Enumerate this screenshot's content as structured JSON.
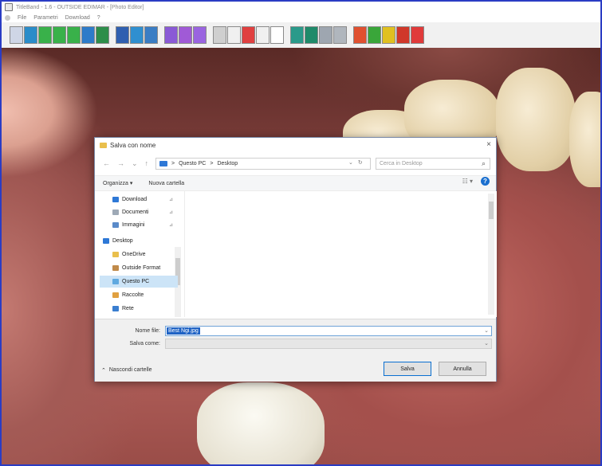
{
  "window": {
    "title": "TitleBand - 1.6 - OUTSIDE EDIMAR - [Photo Editor]"
  },
  "menubar": {
    "items": [
      "File",
      "Parametri",
      "Download",
      "?"
    ]
  },
  "toolbar": {
    "groups": [
      [
        {
          "icon": "grid-icon",
          "color": "#cfd6e6"
        },
        {
          "icon": "arrows-icon",
          "color": "#2a8cc9"
        },
        {
          "icon": "rotate-left-icon",
          "color": "#39b14a"
        },
        {
          "icon": "rotate-right-icon",
          "color": "#39b14a"
        },
        {
          "icon": "flip-icon",
          "color": "#39b14a"
        },
        {
          "icon": "crop-icon",
          "color": "#2d7bc9"
        },
        {
          "icon": "image-icon",
          "color": "#2d8e4a"
        }
      ],
      [
        {
          "icon": "portrait-icon",
          "color": "#2f5fb0"
        },
        {
          "icon": "landscape-icon",
          "color": "#2f8fd0"
        },
        {
          "icon": "contrast-icon",
          "color": "#3a7dc4"
        }
      ],
      [
        {
          "icon": "width-icon",
          "color": "#8a5ad6"
        },
        {
          "icon": "height-icon",
          "color": "#a05ad6"
        },
        {
          "icon": "zoom-icon",
          "color": "#9a64e0"
        }
      ],
      [
        {
          "icon": "frame-icon",
          "color": "#cfcfcf"
        },
        {
          "icon": "pointer-icon",
          "color": "#f0f0f0"
        },
        {
          "icon": "lips-icon",
          "color": "#e04040"
        },
        {
          "icon": "tooth-icon",
          "color": "#f0f0f0"
        },
        {
          "icon": "target-icon",
          "color": "#ffffff"
        }
      ],
      [
        {
          "icon": "print-icon",
          "color": "#2a9a8a"
        },
        {
          "icon": "save-icon",
          "color": "#1f8a6a"
        },
        {
          "icon": "scan-icon",
          "color": "#9ea6b0"
        },
        {
          "icon": "document-icon",
          "color": "#b0b6bd"
        }
      ],
      [
        {
          "icon": "pdf-icon",
          "color": "#e05030"
        },
        {
          "icon": "check-icon",
          "color": "#3aa63a"
        },
        {
          "icon": "info-icon",
          "color": "#e0c020"
        },
        {
          "icon": "exit-icon",
          "color": "#d0382a"
        },
        {
          "icon": "power-icon",
          "color": "#e03a3a"
        }
      ]
    ]
  },
  "dialog": {
    "title": "Salva con nome",
    "close_glyph": "×",
    "nav_glyphs": [
      "←",
      "→",
      "⌄",
      "↑"
    ],
    "breadcrumb": [
      "Questo PC",
      "Desktop"
    ],
    "breadcrumb_sep": ">",
    "address_tail": [
      "⌄",
      "↻"
    ],
    "search_placeholder": "Cerca in Desktop",
    "search_glyph": "⌕",
    "organize_label": "Organizza ▾",
    "new_folder_label": "Nuova cartella",
    "view_glyph": "☷ ▾",
    "help_glyph": "?",
    "nav_items": [
      {
        "label": "Download",
        "icon": "download-icon",
        "color": "#2e78d6",
        "pinned": true,
        "selected": false
      },
      {
        "label": "Documenti",
        "icon": "documents-icon",
        "color": "#9ea9b6",
        "pinned": true,
        "selected": false
      },
      {
        "label": "Immagini",
        "icon": "pictures-icon",
        "color": "#5a8bc9",
        "pinned": true,
        "selected": false
      },
      {
        "label": "Desktop",
        "icon": "desktop-icon",
        "color": "#2e78d6",
        "pinned": false,
        "selected": false
      },
      {
        "label": "OneDrive",
        "icon": "onedrive-folder-icon",
        "color": "#e9bf4c",
        "pinned": false,
        "selected": false
      },
      {
        "label": "Outside Format",
        "icon": "user-icon",
        "color": "#c08a4a",
        "pinned": false,
        "selected": false
      },
      {
        "label": "Questo PC",
        "icon": "this-pc-icon",
        "color": "#5fa9e0",
        "pinned": false,
        "selected": true
      },
      {
        "label": "Raccolte",
        "icon": "libraries-icon",
        "color": "#e0a040",
        "pinned": false,
        "selected": false
      },
      {
        "label": "Rete",
        "icon": "network-icon",
        "color": "#3a7ed0",
        "pinned": false,
        "selected": false
      }
    ],
    "pin_glyph": "⊿",
    "filename_label": "Nome file:",
    "filename_value": "Best Ngi.jpg",
    "filetype_label": "Salva come:",
    "filetype_value": "",
    "hide_folders_label": "Nascondi cartelle",
    "hide_folders_glyph": "⌃",
    "save_label": "Salva",
    "cancel_label": "Annulla"
  }
}
